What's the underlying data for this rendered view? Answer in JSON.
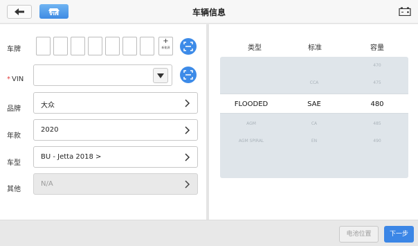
{
  "header": {
    "title": "车辆信息",
    "vin_button_label": "VIN"
  },
  "left": {
    "plate": {
      "label": "车牌",
      "new_energy_plus": "+",
      "new_energy_label": "新能源"
    },
    "vin": {
      "label": "VIN",
      "required_mark": "*",
      "value": ""
    },
    "brand": {
      "label": "品牌",
      "value": "大众"
    },
    "year": {
      "label": "年款",
      "value": "2020"
    },
    "model": {
      "label": "车型",
      "value": "BU - Jetta 2018 >"
    },
    "other": {
      "label": "其他",
      "value": "N/A"
    }
  },
  "right": {
    "columns": [
      "类型",
      "标准",
      "容量"
    ],
    "picker_above": [
      [
        "",
        "",
        "470"
      ],
      [
        "",
        "CCA",
        "475"
      ]
    ],
    "picker_selected": [
      "FLOODED",
      "SAE",
      "480"
    ],
    "picker_below": [
      [
        "AGM",
        "CA",
        "485"
      ],
      [
        "AGM SPIRAL",
        "EN",
        "490"
      ]
    ]
  },
  "footer": {
    "battery_location_label": "电池位置",
    "next_label": "下一步"
  },
  "colors": {
    "accent": "#3b86e6",
    "disabled_bg": "#e9e9e9",
    "picker_bg": "#dfe5ea"
  },
  "icons": [
    "back-arrow-icon",
    "vin-car-icon",
    "battery-icon",
    "scan-icon",
    "dropdown-triangle-icon",
    "chevron-right-icon"
  ]
}
